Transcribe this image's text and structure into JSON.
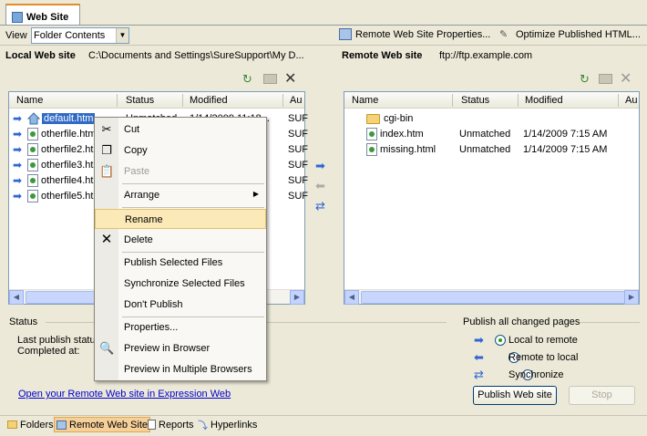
{
  "tab": {
    "title": "Web Site"
  },
  "toolbar": {
    "view_label": "View",
    "view_value": "Folder Contents",
    "remote_props": "Remote Web Site Properties...",
    "optimize": "Optimize Published HTML..."
  },
  "local": {
    "label": "Local Web site",
    "path": "C:\\Documents and Settings\\SureSupport\\My D...",
    "columns": [
      "Name",
      "Status",
      "Modified",
      "Au"
    ],
    "files": [
      {
        "name": "default.htm",
        "status": "Unmatched",
        "modified": "1/14/2009 11:18...",
        "author": "SUF"
      },
      {
        "name": "otherfile.htm",
        "status": "",
        "modified": "",
        "author": "SUF"
      },
      {
        "name": "otherfile2.htm",
        "status": "",
        "modified": "",
        "author": "SUF"
      },
      {
        "name": "otherfile3.htm",
        "status": "",
        "modified": "",
        "author": "SUF"
      },
      {
        "name": "otherfile4.htm",
        "status": "",
        "modified": "",
        "author": "SUF"
      },
      {
        "name": "otherfile5.htm",
        "status": "",
        "modified": "",
        "author": "SUF"
      }
    ]
  },
  "remote": {
    "label": "Remote Web site",
    "path": "ftp://ftp.example.com",
    "columns": [
      "Name",
      "Status",
      "Modified",
      "Au"
    ],
    "files": [
      {
        "name": "cgi-bin",
        "status": "",
        "modified": "",
        "folder": true
      },
      {
        "name": "index.htm",
        "status": "Unmatched",
        "modified": "1/14/2009 7:15 AM",
        "folder": false
      },
      {
        "name": "missing.html",
        "status": "Unmatched",
        "modified": "1/14/2009 7:15 AM",
        "folder": false
      }
    ]
  },
  "status": {
    "heading": "Status",
    "last_publish": "Last publish statu",
    "completed": "Completed at:",
    "open_link": "Open your Remote Web site in Expression Web"
  },
  "publish": {
    "heading": "Publish all changed pages",
    "options": [
      {
        "label": "Local to remote",
        "selected": true
      },
      {
        "label": "Remote to local",
        "selected": false
      },
      {
        "label": "Synchronize",
        "selected": false
      }
    ],
    "publish_button": "Publish Web site",
    "stop_button": "Stop"
  },
  "bottom_tabs": [
    {
      "label": "Folders",
      "active": false
    },
    {
      "label": "Remote Web Site",
      "active": true
    },
    {
      "label": "Reports",
      "active": false
    },
    {
      "label": "Hyperlinks",
      "active": false
    }
  ],
  "context_menu": {
    "cut": "Cut",
    "copy": "Copy",
    "paste": "Paste",
    "arrange": "Arrange",
    "rename": "Rename",
    "delete": "Delete",
    "publish_selected": "Publish Selected Files",
    "sync_selected": "Synchronize Selected Files",
    "dont_publish": "Don't Publish",
    "properties": "Properties...",
    "preview_browser": "Preview in Browser",
    "preview_multiple": "Preview in Multiple Browsers"
  },
  "colors": {
    "accent_orange": "#e68b2c",
    "link_blue": "#0000cc",
    "highlight": "#fbe9b7",
    "selection": "#316ac5"
  }
}
